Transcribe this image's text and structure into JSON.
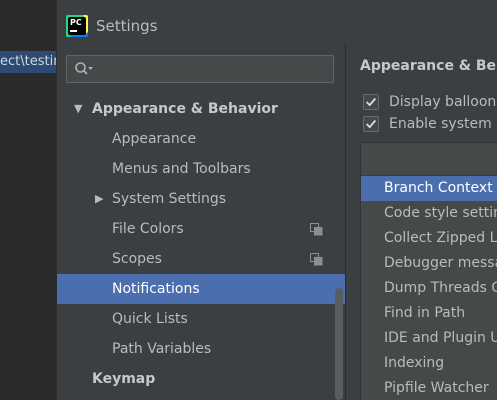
{
  "background": {
    "path_text": "ect\\testin"
  },
  "window": {
    "title": "Settings",
    "app_icon_text": "PC"
  },
  "search": {
    "value": "",
    "placeholder": ""
  },
  "tree": {
    "items": [
      {
        "label": "Appearance & Behavior",
        "arrow": "▼",
        "bold": true,
        "selected": false
      },
      {
        "label": "Appearance",
        "arrow": "",
        "bold": false,
        "selected": false
      },
      {
        "label": "Menus and Toolbars",
        "arrow": "",
        "bold": false,
        "selected": false
      },
      {
        "label": "System Settings",
        "arrow": "▶",
        "bold": false,
        "selected": false
      },
      {
        "label": "File Colors",
        "arrow": "",
        "bold": false,
        "selected": false,
        "icon": "project-copy-icon"
      },
      {
        "label": "Scopes",
        "arrow": "",
        "bold": false,
        "selected": false,
        "icon": "project-copy-icon"
      },
      {
        "label": "Notifications",
        "arrow": "",
        "bold": false,
        "selected": true
      },
      {
        "label": "Quick Lists",
        "arrow": "",
        "bold": false,
        "selected": false
      },
      {
        "label": "Path Variables",
        "arrow": "",
        "bold": false,
        "selected": false
      },
      {
        "label": "Keymap",
        "arrow": "",
        "bold": true,
        "selected": false
      }
    ]
  },
  "panel": {
    "section_title": "Appearance & Beha",
    "checkboxes": [
      {
        "label": "Display balloon",
        "checked": true
      },
      {
        "label": "Enable system no",
        "checked": true
      }
    ],
    "rows": [
      {
        "label": "Branch Context g",
        "selected": true
      },
      {
        "label": "Code style setting",
        "selected": false
      },
      {
        "label": "Collect Zipped Lo",
        "selected": false
      },
      {
        "label": "Debugger messa",
        "selected": false
      },
      {
        "label": "Dump Threads Gr",
        "selected": false
      },
      {
        "label": "Find in Path",
        "selected": false
      },
      {
        "label": "IDE and Plugin Up",
        "selected": false
      },
      {
        "label": "Indexing",
        "selected": false
      },
      {
        "label": "Pipfile Watcher",
        "selected": false
      }
    ]
  },
  "colors": {
    "selection": "#4b6eaf",
    "window_bg": "#3c3f41",
    "text": "#bbbbbb"
  }
}
